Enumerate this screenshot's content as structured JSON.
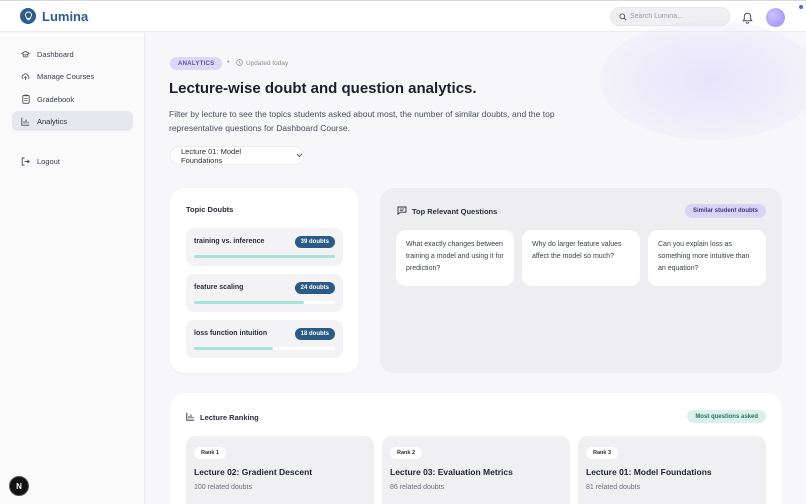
{
  "app": {
    "name": "Lumina",
    "search_placeholder": "Search Lumina..."
  },
  "sidebar": {
    "items": [
      {
        "label": "Dashboard",
        "icon": "graduation-cap-icon"
      },
      {
        "label": "Manage Courses",
        "icon": "cloud-upload-icon"
      },
      {
        "label": "Gradebook",
        "icon": "clipboard-icon"
      },
      {
        "label": "Analytics",
        "icon": "bar-chart-icon",
        "active": true
      }
    ],
    "logout": "Logout"
  },
  "header": {
    "badge": "ANALYTICS",
    "updated": "Updated today",
    "title": "Lecture-wise doubt and question analytics.",
    "description": "Filter by lecture to see the topics students asked about most, the number of similar doubts, and the top representative questions for Dashboard Course.",
    "lecture_select": "Lecture 01: Model Foundations"
  },
  "topic_doubts": {
    "title": "Topic Doubts",
    "items": [
      {
        "label": "training vs. inference",
        "count": "39 doubts",
        "fraction": 1.0
      },
      {
        "label": "feature scaling",
        "count": "24 doubts",
        "fraction": 0.78
      },
      {
        "label": "loss function intuition",
        "count": "18 doubts",
        "fraction": 0.56
      }
    ]
  },
  "questions": {
    "title": "Top Relevant Questions",
    "badge": "Similar student doubts",
    "items": [
      "What exactly changes between training a model and using it for prediction?",
      "Why do larger feature values affect the model so much?",
      "Can you explain loss as something more intuitive than an equation?"
    ]
  },
  "ranking": {
    "title": "Lecture Ranking",
    "badge": "Most questions asked",
    "items": [
      {
        "rank": "Rank 1",
        "name": "Lecture 02: Gradient Descent",
        "count": "100 related doubts"
      },
      {
        "rank": "Rank 2",
        "name": "Lecture 03: Evaluation Metrics",
        "count": "86 related doubts"
      },
      {
        "rank": "Rank 3",
        "name": "Lecture 01: Model Foundations",
        "count": "81 related doubts"
      }
    ]
  },
  "fab": {
    "label": "N"
  }
}
